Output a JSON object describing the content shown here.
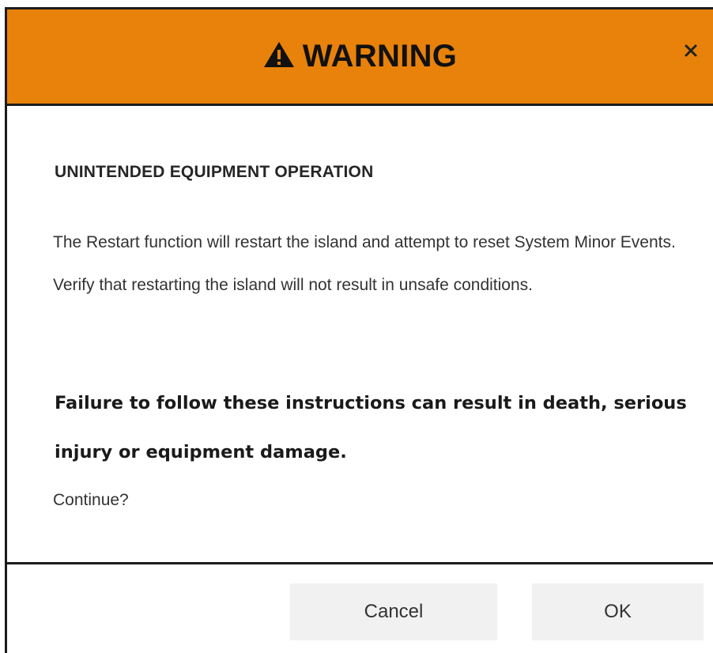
{
  "dialog": {
    "title": "WARNING",
    "title_icon": "warning-triangle-icon",
    "close_icon": "close-icon",
    "header_color": "#e8820b"
  },
  "content": {
    "heading": "UNINTENDED EQUIPMENT OPERATION",
    "description": "The Restart function will restart the island and attempt to reset System Minor Events. Verify that restarting the island will not result in unsafe conditions.",
    "emphasis": "Failure to follow these instructions can result in death, serious injury or equipment damage.",
    "question": "Continue?"
  },
  "buttons": {
    "cancel_label": "Cancel",
    "ok_label": "OK"
  }
}
